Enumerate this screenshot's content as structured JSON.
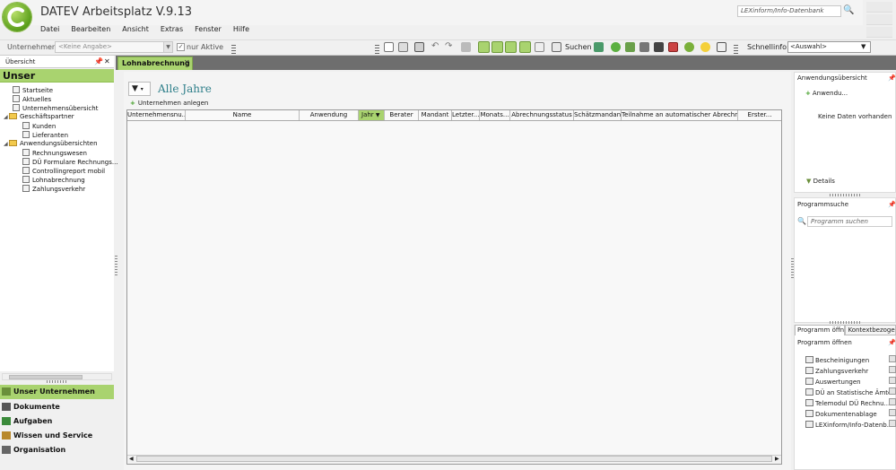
{
  "app": {
    "title": "DATEV Arbeitsplatz V.9.13"
  },
  "menu": [
    "Datei",
    "Bearbeiten",
    "Ansicht",
    "Extras",
    "Fenster",
    "Hilfe"
  ],
  "lexsearch": {
    "placeholder": "LEXinform/Info-Datenbank"
  },
  "toolbar": {
    "unternehmen_label": "Unternehmen:",
    "unternehmen_value": "<Keine Angabe>",
    "nur_aktive_label": "nur Aktive",
    "suchen_label": "Suchen",
    "schnellinfo_label": "Schnellinfo:",
    "schnellinfo_value": "<Auswahl>"
  },
  "left_panel": {
    "header": "Übersicht",
    "section_title": "Unser Unternehmen",
    "tree": [
      {
        "label": "Startseite"
      },
      {
        "label": "Aktuelles"
      },
      {
        "label": "Unternehmensübersicht"
      },
      {
        "label": "Geschäftspartner"
      },
      {
        "label": "Kunden"
      },
      {
        "label": "Lieferanten"
      },
      {
        "label": "Anwendungsübersichten"
      },
      {
        "label": "Rechnungswesen"
      },
      {
        "label": "DÜ Formulare Rechnungs..."
      },
      {
        "label": "Controllingreport mobil"
      },
      {
        "label": "Lohnabrechnung"
      },
      {
        "label": "Zahlungsverkehr"
      }
    ],
    "nav": [
      "Unser Unternehmen",
      "Dokumente",
      "Aufgaben",
      "Wissen und Service",
      "Organisation"
    ]
  },
  "tabs": [
    {
      "label": "Lohnabrechnung"
    }
  ],
  "main": {
    "filter_title": "Alle Jahre",
    "create_label": "Unternehmen anlegen",
    "columns": [
      "Unternehmensnu...",
      "Name",
      "Anwendung",
      "Jahr",
      "Berater",
      "Mandant",
      "Letzter...",
      "Monats...",
      "Abrechnungsstatus",
      "Schätzmandant",
      "Teilnahme an automatischer Abrechn...",
      "Erster..."
    ]
  },
  "right_panel": {
    "anw_header": "Anwendungsübersicht",
    "anw_button": "Anwendu...",
    "anw_empty": "Keine Daten vorhanden",
    "details": "Details",
    "ps_header": "Programmsuche",
    "ps_placeholder": "Programm suchen",
    "tabs": [
      "Programm öffnen",
      "Kontextbezogene"
    ],
    "po_header": "Programm öffnen",
    "programs": [
      "Bescheinigungen",
      "Zahlungsverkehr",
      "Auswertungen",
      "DÜ an Statistische Ämter",
      "Telemodul DÜ Rechnu...",
      "Dokumentenablage",
      "LEXinform/Info-Datenb..."
    ]
  },
  "colors": {
    "accent": "#a9d36f",
    "tabstrip": "#6e6e6e",
    "title_teal": "#2f7f8a"
  }
}
